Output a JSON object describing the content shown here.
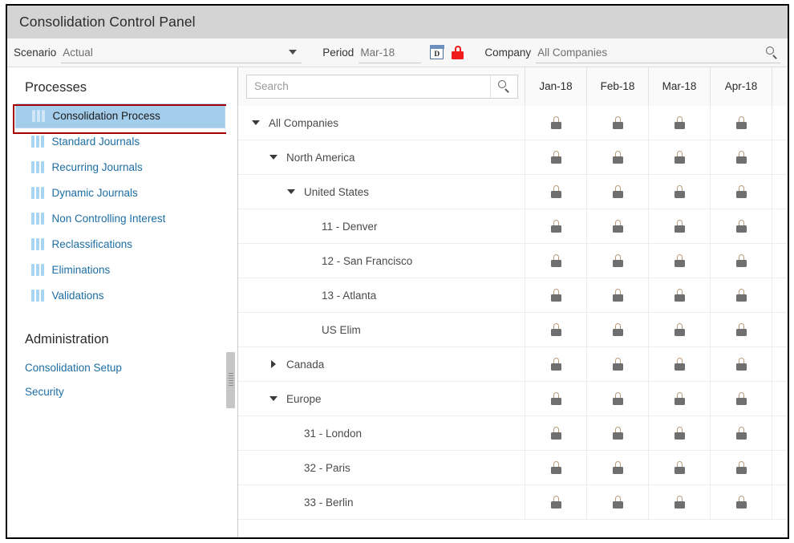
{
  "window": {
    "title": "Consolidation Control Panel"
  },
  "toolbar": {
    "scenario_label": "Scenario",
    "scenario_value": "Actual",
    "scenario_caret_icon": "chevron-down-icon",
    "period_label": "Period",
    "period_value": "Mar-18",
    "period_calendar_icon": "calendar-day-icon",
    "period_calendar_glyph": "D",
    "period_lock_icon": "lock-closed-red-icon",
    "company_label": "Company",
    "company_value": "All Companies",
    "company_search_icon": "search-icon"
  },
  "sidebar": {
    "processes_heading": "Processes",
    "processes": [
      {
        "label": "Consolidation Process",
        "icon": "bars-icon",
        "selected": true
      },
      {
        "label": "Standard Journals",
        "icon": "bars-icon",
        "selected": false
      },
      {
        "label": "Recurring Journals",
        "icon": "bars-icon",
        "selected": false
      },
      {
        "label": "Dynamic Journals",
        "icon": "bars-icon",
        "selected": false
      },
      {
        "label": "Non Controlling Interest",
        "icon": "bars-icon",
        "selected": false
      },
      {
        "label": "Reclassifications",
        "icon": "bars-icon",
        "selected": false
      },
      {
        "label": "Eliminations",
        "icon": "bars-icon",
        "selected": false
      },
      {
        "label": "Validations",
        "icon": "bars-icon",
        "selected": false
      }
    ],
    "administration_heading": "Administration",
    "administration": [
      {
        "label": "Consolidation Setup"
      },
      {
        "label": "Security"
      }
    ],
    "annotation_color": "#a40000",
    "selected_highlight_color": "#a3cdeb",
    "link_color": "#1c6ea4"
  },
  "grid": {
    "search_placeholder": "Search",
    "search_icon": "search-icon",
    "columns": [
      "Jan-18",
      "Feb-18",
      "Mar-18",
      "Apr-18"
    ],
    "lock_icon": "lock-closed-icon",
    "rows": [
      {
        "name": "All Companies",
        "level": 0,
        "twisty": "down"
      },
      {
        "name": "North America",
        "level": 1,
        "twisty": "down"
      },
      {
        "name": "United States",
        "level": 2,
        "twisty": "down"
      },
      {
        "name": "11 - Denver",
        "level": 3,
        "twisty": "none"
      },
      {
        "name": "12 - San Francisco",
        "level": 3,
        "twisty": "none"
      },
      {
        "name": "13 - Atlanta",
        "level": 3,
        "twisty": "none"
      },
      {
        "name": "US Elim",
        "level": 3,
        "twisty": "none"
      },
      {
        "name": "Canada",
        "level": 1,
        "twisty": "right"
      },
      {
        "name": "Europe",
        "level": 1,
        "twisty": "down"
      },
      {
        "name": "31 - London",
        "level": 2,
        "twisty": "none"
      },
      {
        "name": "32 - Paris",
        "level": 2,
        "twisty": "none"
      },
      {
        "name": "33 - Berlin",
        "level": 2,
        "twisty": "none"
      }
    ]
  }
}
